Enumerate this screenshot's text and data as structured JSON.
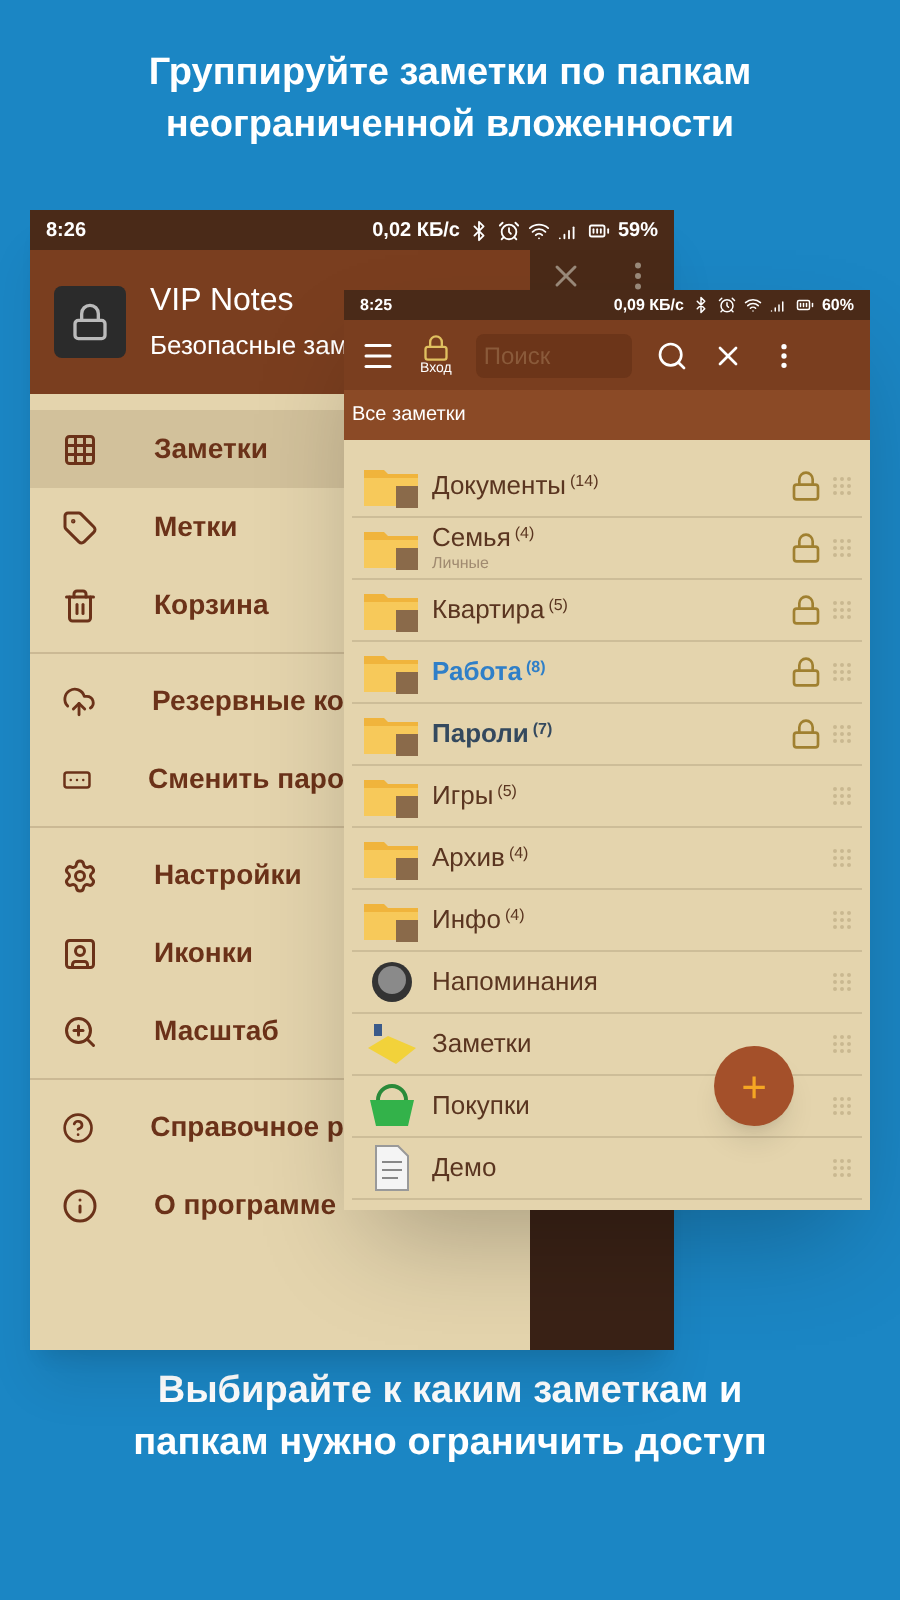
{
  "headline": "Группируйте заметки по папкам неограниченной вложенности",
  "back_phone": {
    "status_bar": {
      "time": "8:26",
      "speed": "0,02 КБ/с",
      "battery": "59%"
    },
    "drawer": {
      "app_name": "VIP Notes",
      "subtitle": "Безопасные зам",
      "groups": [
        [
          {
            "label": "Заметки",
            "selected": true
          },
          {
            "label": "Метки",
            "selected": false
          },
          {
            "label": "Корзина",
            "selected": false
          }
        ],
        [
          {
            "label": "Резервные ко",
            "selected": false
          },
          {
            "label": "Сменить паро",
            "selected": false
          }
        ],
        [
          {
            "label": "Настройки",
            "selected": false
          },
          {
            "label": "Иконки",
            "selected": false
          },
          {
            "label": "Масштаб",
            "selected": false
          }
        ],
        [
          {
            "label": "Справочное р",
            "selected": false
          },
          {
            "label": "О программе",
            "selected": false
          }
        ]
      ]
    }
  },
  "front_phone": {
    "status_bar": {
      "time": "8:25",
      "speed": "0,09 КБ/с",
      "battery": "60%"
    },
    "toolbar": {
      "login_label": "Вход",
      "search_placeholder": "Поиск"
    },
    "breadcrumb": "Все заметки",
    "items": [
      {
        "kind": "folder",
        "name": "Документы",
        "count": "(14)",
        "locked": true,
        "color": "#5a3520",
        "bold": false
      },
      {
        "kind": "folder",
        "name": "Семья",
        "count": "(4)",
        "subtitle": "Личные",
        "locked": true,
        "color": "#5a3520",
        "bold": false
      },
      {
        "kind": "folder",
        "name": "Квартира",
        "count": "(5)",
        "locked": true,
        "color": "#5a3520",
        "bold": false
      },
      {
        "kind": "folder",
        "name": "Работа",
        "count": "(8)",
        "locked": true,
        "color": "#2f7fc8",
        "bold": true
      },
      {
        "kind": "folder",
        "name": "Пароли",
        "count": "(7)",
        "locked": true,
        "color": "#34495e",
        "bold": true
      },
      {
        "kind": "folder",
        "name": "Игры",
        "count": "(5)",
        "locked": false,
        "color": "#5a3520",
        "bold": false
      },
      {
        "kind": "folder",
        "name": "Архив",
        "count": "(4)",
        "locked": false,
        "color": "#5a3520",
        "bold": false
      },
      {
        "kind": "folder",
        "name": "Инфо",
        "count": "(4)",
        "locked": false,
        "color": "#5a3520",
        "bold": false
      },
      {
        "kind": "reminder",
        "name": "Напоминания",
        "locked": false,
        "color": "#5a3520",
        "bold": false
      },
      {
        "kind": "note",
        "name": "Заметки",
        "locked": false,
        "color": "#5a3520",
        "bold": false
      },
      {
        "kind": "basket",
        "name": "Покупки",
        "locked": false,
        "color": "#5a3520",
        "bold": false
      },
      {
        "kind": "document",
        "name": "Демо",
        "locked": false,
        "color": "#5a3520",
        "bold": false
      }
    ],
    "fab": "+"
  },
  "footer": "Выбирайте к каким заметкам и папкам нужно ограничить доступ"
}
